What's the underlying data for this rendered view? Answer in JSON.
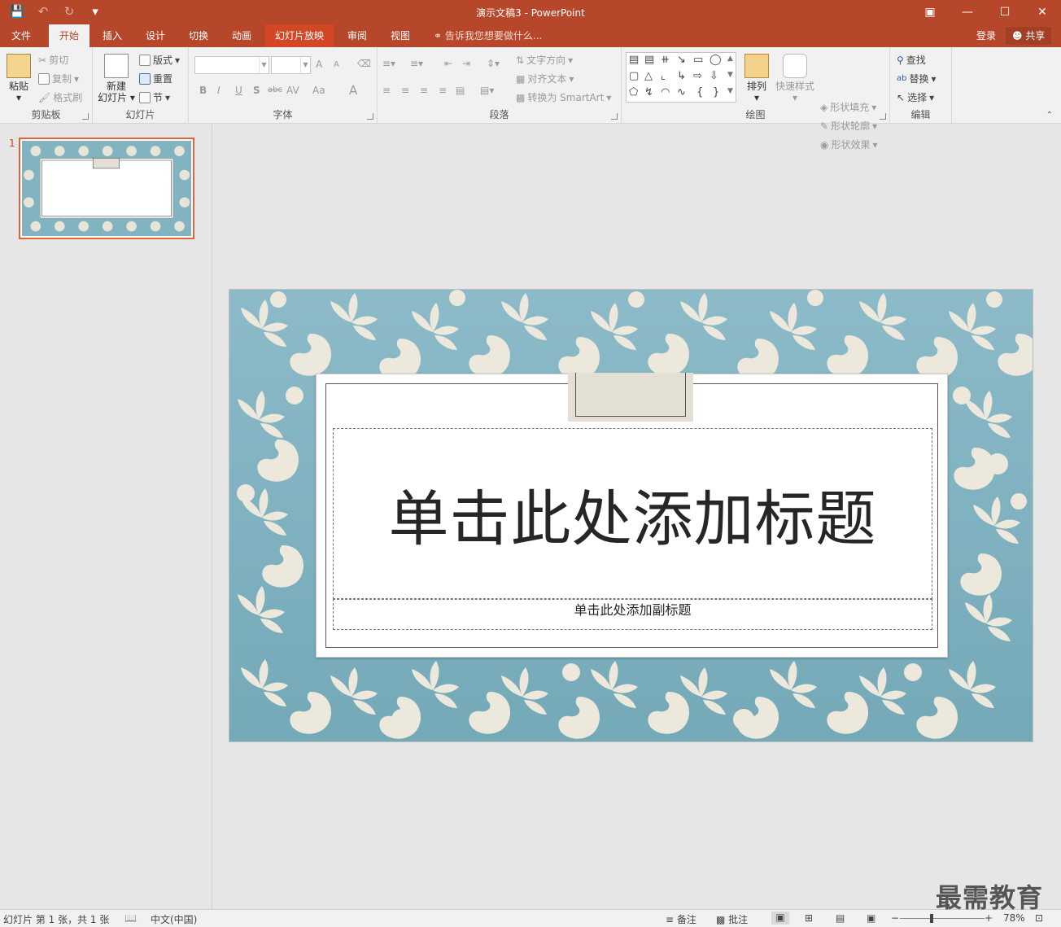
{
  "app": {
    "title": "演示文稿3 - PowerPoint"
  },
  "tabs": [
    {
      "label": "文件"
    },
    {
      "label": "开始"
    },
    {
      "label": "插入"
    },
    {
      "label": "设计"
    },
    {
      "label": "切换"
    },
    {
      "label": "动画"
    },
    {
      "label": "幻灯片放映"
    },
    {
      "label": "审阅"
    },
    {
      "label": "视图"
    }
  ],
  "tellme": "告诉我您想要做什么...",
  "account": {
    "login": "登录",
    "share": "共享"
  },
  "ribbon": {
    "clipboard": {
      "label": "剪贴板",
      "paste": "粘贴",
      "cut": "剪切",
      "copy": "复制",
      "format_painter": "格式刷"
    },
    "slides": {
      "label": "幻灯片",
      "new_slide_1": "新建",
      "new_slide_2": "幻灯片",
      "layout": "版式",
      "reset": "重置",
      "section": "节"
    },
    "font": {
      "label": "字体",
      "bold": "B",
      "italic": "I",
      "underline": "U",
      "shadow": "S",
      "strike": "abc",
      "spacing": "AV",
      "case": "Aa",
      "grow": "A",
      "shrink": "A",
      "color": "A"
    },
    "paragraph": {
      "label": "段落",
      "text_direction": "文字方向",
      "align_text": "对齐文本",
      "smartart": "转换为 SmartArt"
    },
    "drawing": {
      "label": "绘图",
      "arrange": "排列",
      "quick_styles": "快速样式",
      "fill": "形状填充",
      "outline": "形状轮廓",
      "effects": "形状效果"
    },
    "editing": {
      "label": "编辑",
      "find": "查找",
      "replace": "替换",
      "select": "选择"
    }
  },
  "thumbnail": {
    "number": "1"
  },
  "slide": {
    "title_placeholder": "单击此处添加标题",
    "subtitle_placeholder": "单击此处添加副标题",
    "colors": {
      "bg_top": "#8cbac8",
      "bg_bottom": "#74a9b8",
      "motif": "#ede8dc",
      "tag": "#e3dfd5"
    }
  },
  "status": {
    "slide_info": "幻灯片 第 1 张，共 1 张",
    "language": "中文(中国)",
    "notes": "备注",
    "comments": "批注",
    "zoom": "78%"
  },
  "watermark": "最需教育",
  "colors": {
    "accent": "#b7472a",
    "tab_highlight": "#d24726"
  }
}
